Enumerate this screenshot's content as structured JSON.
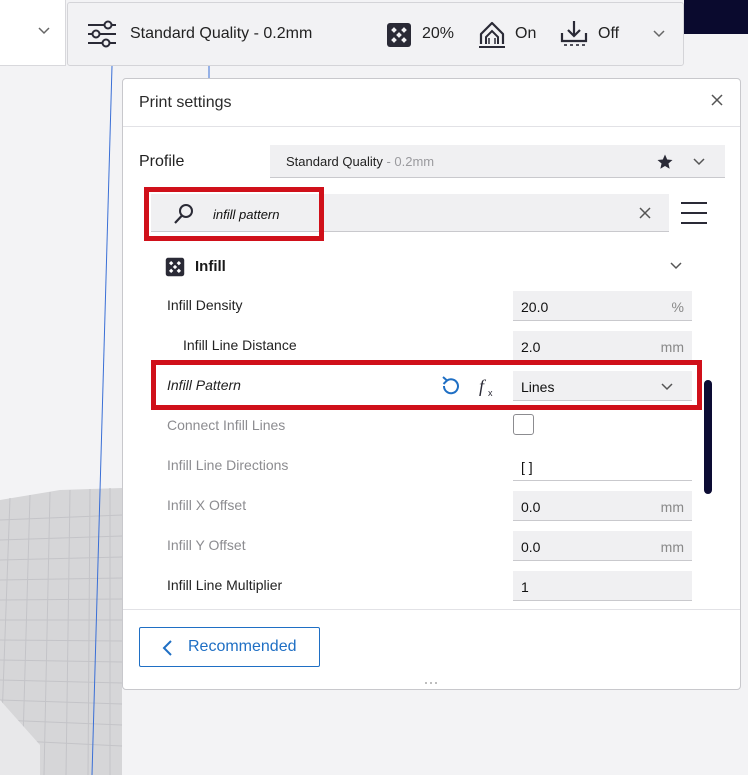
{
  "toolbar": {
    "quality_label": "Standard Quality - 0.2mm",
    "infill_label": "20%",
    "support_label": "On",
    "adhesion_label": "Off",
    "icons": [
      "settings-sliders-icon",
      "infill-icon",
      "support-icon",
      "adhesion-icon",
      "chevron-down-icon"
    ]
  },
  "panel": {
    "title": "Print settings",
    "profile_label": "Profile",
    "profile_value": "Standard Quality",
    "profile_value_sub": " - 0.2mm",
    "search_value": "infill pattern",
    "category_label": "Infill",
    "settings": [
      {
        "label": "Infill Density",
        "value": "20.0",
        "unit": "%",
        "enabled": true,
        "indent": false
      },
      {
        "label": "Infill Line Distance",
        "value": "2.0",
        "unit": "mm",
        "enabled": true,
        "indent": true
      },
      {
        "label": "Infill Pattern",
        "value": "Lines",
        "unit": "",
        "enabled": true,
        "indent": false,
        "type": "dropdown"
      },
      {
        "label": "Connect Infill Lines",
        "value": "",
        "unit": "",
        "enabled": false,
        "indent": false,
        "type": "checkbox",
        "checked": false
      },
      {
        "label": "Infill Line Directions",
        "value": "[ ]",
        "unit": "",
        "enabled": false,
        "indent": false
      },
      {
        "label": "Infill X Offset",
        "value": "0.0",
        "unit": "mm",
        "enabled": false,
        "indent": false
      },
      {
        "label": "Infill Y Offset",
        "value": "0.0",
        "unit": "mm",
        "enabled": false,
        "indent": false
      },
      {
        "label": "Infill Line Multiplier",
        "value": "1",
        "unit": "",
        "enabled": true,
        "indent": false
      }
    ],
    "recommended_label": "Recommended"
  },
  "colors": {
    "highlight": "#d0101a",
    "accent": "#1f6fc4",
    "scrollbar": "#0c0c34",
    "reset_icon": "#1f6fc4"
  }
}
